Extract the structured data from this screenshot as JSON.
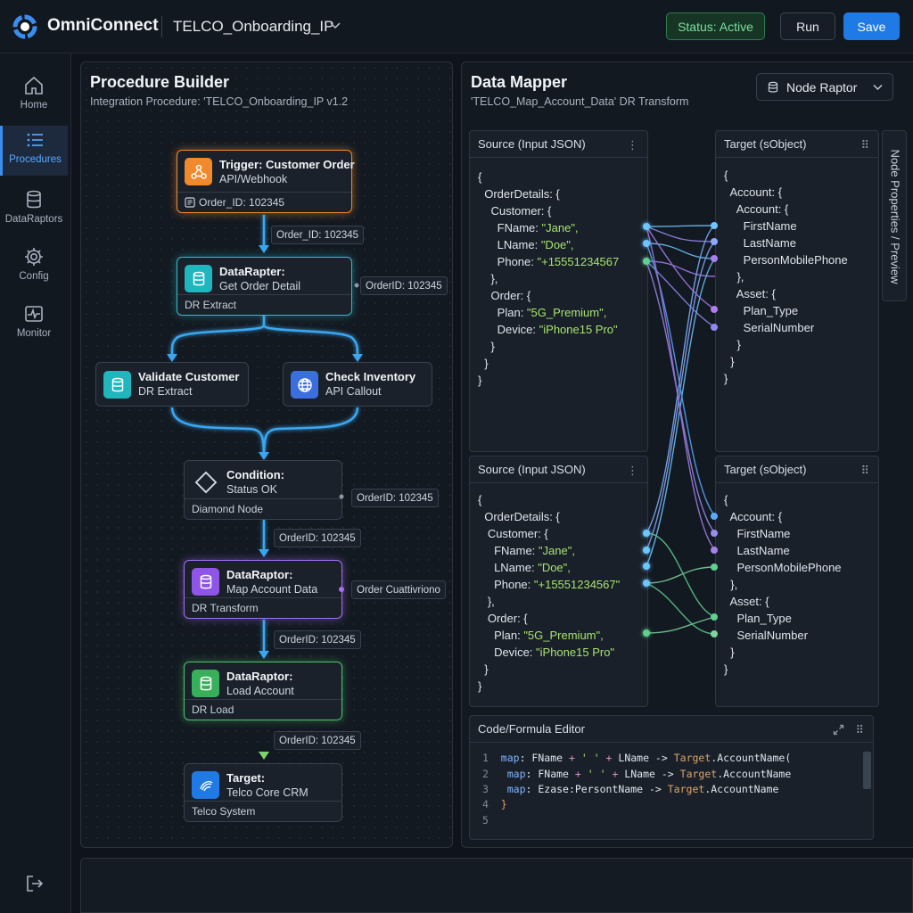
{
  "app": {
    "brand": "OmniConnect",
    "project": "TELCO_Onboarding_IP",
    "status": "Status: Active",
    "run_label": "Run",
    "save_label": "Save"
  },
  "sidebar": {
    "items": [
      {
        "label": "Home",
        "icon": "home-icon"
      },
      {
        "label": "Procedures",
        "icon": "list-icon",
        "active": true
      },
      {
        "label": "DataRaptors",
        "icon": "database-icon"
      },
      {
        "label": "Config",
        "icon": "gear-icon"
      },
      {
        "label": "Monitor",
        "icon": "pulse-icon"
      }
    ]
  },
  "procedure": {
    "title": "Procedure Builder",
    "subtitle": "Integration Procedure: 'TELCO_Onboarding_IP v1.2",
    "nodes": {
      "trigger": {
        "title": "Trigger: Customer Order",
        "sub": "API/Webhook",
        "foot": "Order_ID: 102345"
      },
      "get_order": {
        "title": "DataRapter:",
        "sub": "Get Order Detail",
        "foot": "DR Extract"
      },
      "validate": {
        "title": "Validate Customer",
        "sub": "DR Extract"
      },
      "inventory": {
        "title": "Check Inventory",
        "sub": "API Callout"
      },
      "condition": {
        "title": "Condition:",
        "sub": "Status OK",
        "foot": "Diamond Node"
      },
      "map_account": {
        "title": "DataRaptor:",
        "sub": "Map Account Data",
        "foot": "DR Transform"
      },
      "load_account": {
        "title": "DataRaptor:",
        "sub": "Load Account",
        "foot": "DR Load"
      },
      "target": {
        "title": "Target:",
        "sub": "Telco Core CRM",
        "foot": "Telco System"
      }
    },
    "tags": [
      "Order_ID: 102345",
      "OrderID: 102345",
      "OrderID: 102345",
      "OrderID: 102345",
      "Order Cuattivriono",
      "OrderID: 102345",
      "OrderID: 102345",
      "OrderID: 102345"
    ]
  },
  "mapper": {
    "title": "Data Mapper",
    "subtitle": "'TELCO_Map_Account_Data' DR Transform",
    "dropdown": "Node Raptor",
    "side_tab": "Node Properties / Preview",
    "source_title": "Source (Input JSON)",
    "target_title": "Target (sObject)",
    "src1": [
      "{",
      "OrderDetails: {",
      "Customer: {",
      "FName: ",
      "LName: ",
      "Phone: ",
      "},",
      "Order: {",
      "Plan: ",
      "Device: ",
      "}",
      "}",
      "}"
    ],
    "src1_values": [
      "\"Jane\",",
      "\"Doe\",",
      "\"+15551234567",
      "\"5G_Premium\",",
      "\"iPhone15 Pro\""
    ],
    "tgt1": [
      "{",
      "Account: {",
      "Account: {",
      "FirstName",
      "LastName",
      "PersonMobilePhone",
      "},",
      "Asset: {",
      "Plan_Type",
      "SerialNumber",
      "}",
      "}",
      "}"
    ],
    "src2": [
      "{",
      "OrderDetails: {",
      "Customer: {",
      "FName: ",
      "LName: ",
      "Phone: ",
      "},",
      "Order: {",
      "Plan: ",
      "Device: ",
      "}",
      "}"
    ],
    "src2_values": [
      "\"Jane\",",
      "\"Doe\",",
      "\"+15551234567\"",
      "\"5G_Premium\",",
      "\"iPhone15 Pro\""
    ],
    "tgt2": [
      "{",
      "Account: {",
      "FirstName",
      "LastName",
      "PersonMobilePhone",
      "},",
      "Asset: {",
      "Plan_Type",
      "SerialNumber",
      "}",
      "}"
    ]
  },
  "editor": {
    "title": "Code/Formula Editor",
    "lines": [
      {
        "n": "1",
        "a": "map",
        "b": ": FName ",
        "c": "+",
        "d": " ' ' ",
        "e": "+",
        "f": " LName -> ",
        "g": "Target",
        "h": ".AccountName("
      },
      {
        "n": "2",
        "a": "map",
        "b": ": FName ",
        "c": "+",
        "d": " ' ' ",
        "e": "+",
        "f": " LName -> ",
        "g": "Target",
        "h": ".AccountName"
      },
      {
        "n": "3",
        "a": "map",
        "b": ": Ezase:PersontName -> ",
        "c": "",
        "d": "",
        "e": "",
        "f": "",
        "g": "Target",
        "h": ".AccountName"
      },
      {
        "n": "4",
        "a": "}",
        "b": "",
        "c": "",
        "d": "",
        "e": "",
        "f": "",
        "g": "",
        "h": ""
      },
      {
        "n": "5",
        "a": "",
        "b": "",
        "c": "",
        "d": "",
        "e": "",
        "f": "",
        "g": "",
        "h": ""
      }
    ]
  },
  "colors": {
    "accent": "#1f7ae6",
    "trigger": "#f08a2c",
    "extract": "#27c2c9",
    "transform": "#a56ff0",
    "load": "#4cc46a",
    "flow": "#3aa7f0"
  }
}
